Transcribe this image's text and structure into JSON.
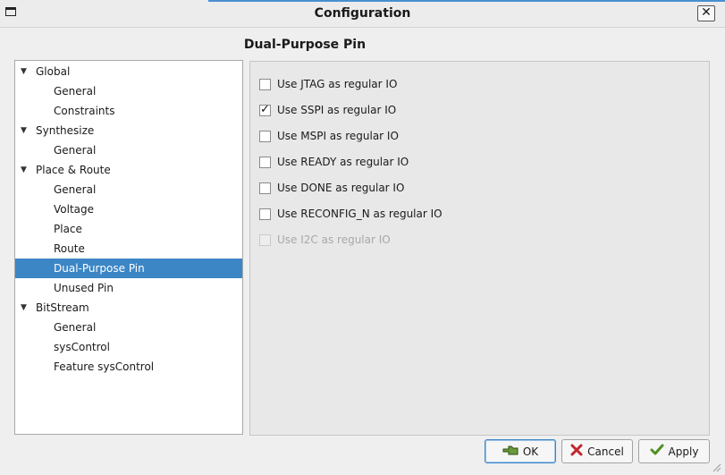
{
  "window": {
    "title": "Configuration",
    "close_label": "✕"
  },
  "page": {
    "heading": "Dual-Purpose Pin"
  },
  "tree": {
    "items": [
      {
        "label": "Global",
        "level": 0,
        "expanded": true,
        "selected": false
      },
      {
        "label": "General",
        "level": 1,
        "selected": false
      },
      {
        "label": "Constraints",
        "level": 1,
        "selected": false
      },
      {
        "label": "Synthesize",
        "level": 0,
        "expanded": true,
        "selected": false
      },
      {
        "label": "General",
        "level": 1,
        "selected": false
      },
      {
        "label": "Place & Route",
        "level": 0,
        "expanded": true,
        "selected": false
      },
      {
        "label": "General",
        "level": 1,
        "selected": false
      },
      {
        "label": "Voltage",
        "level": 1,
        "selected": false
      },
      {
        "label": "Place",
        "level": 1,
        "selected": false
      },
      {
        "label": "Route",
        "level": 1,
        "selected": false
      },
      {
        "label": "Dual-Purpose Pin",
        "level": 1,
        "selected": true
      },
      {
        "label": "Unused Pin",
        "level": 1,
        "selected": false
      },
      {
        "label": "BitStream",
        "level": 0,
        "expanded": true,
        "selected": false
      },
      {
        "label": "General",
        "level": 1,
        "selected": false
      },
      {
        "label": "sysControl",
        "level": 1,
        "selected": false
      },
      {
        "label": "Feature sysControl",
        "level": 1,
        "selected": false
      }
    ]
  },
  "options": [
    {
      "label": "Use JTAG as regular IO",
      "checked": false,
      "enabled": true
    },
    {
      "label": "Use SSPI as regular IO",
      "checked": true,
      "enabled": true
    },
    {
      "label": "Use MSPI as regular IO",
      "checked": false,
      "enabled": true
    },
    {
      "label": "Use READY as regular IO",
      "checked": false,
      "enabled": true
    },
    {
      "label": "Use DONE as regular IO",
      "checked": false,
      "enabled": true
    },
    {
      "label": "Use RECONFIG_N as regular IO",
      "checked": false,
      "enabled": true
    },
    {
      "label": "Use I2C as regular IO",
      "checked": false,
      "enabled": false
    }
  ],
  "buttons": {
    "ok": {
      "label": "OK",
      "icon": "ok-hand-icon"
    },
    "cancel": {
      "label": "Cancel",
      "icon": "red-x-icon"
    },
    "apply": {
      "label": "Apply",
      "icon": "green-check-icon"
    }
  },
  "colors": {
    "selection": "#3d86c6",
    "accent": "#4a8fd1"
  }
}
